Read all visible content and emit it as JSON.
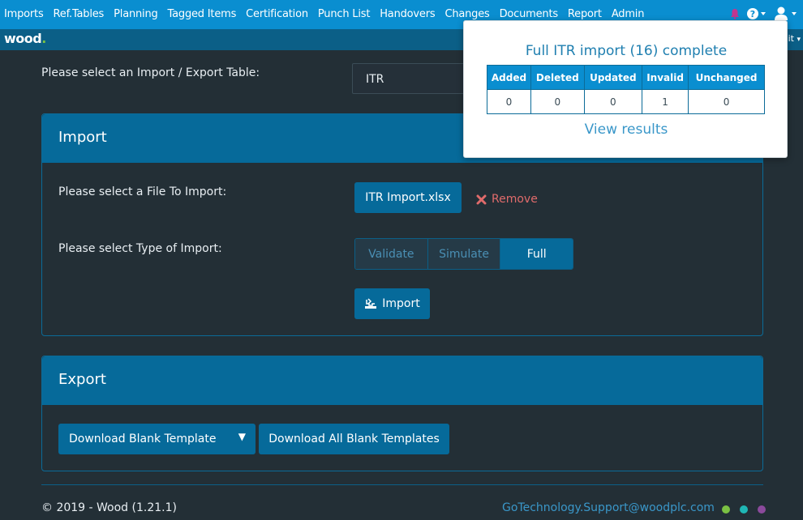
{
  "nav": {
    "items": [
      "Imports",
      "Ref.Tables",
      "Planning",
      "Tagged Items",
      "Certification",
      "Punch List",
      "Handovers",
      "Changes",
      "Documents",
      "Report",
      "Admin"
    ]
  },
  "icons": {
    "bell": "bell-icon",
    "help": "help-icon",
    "user": "user-icon"
  },
  "brand": {
    "logo_text": "wood",
    "logo_dot": ".",
    "subbar_right": "it"
  },
  "form": {
    "select_label": "Please select an Import / Export Table:",
    "select_value": "ITR"
  },
  "import": {
    "title": "Import",
    "file_label": "Please select a File To Import:",
    "file_button": "ITR Import.xlsx",
    "remove_label": "Remove",
    "type_label": "Please select Type of Import:",
    "types": [
      "Validate",
      "Simulate",
      "Full"
    ],
    "selected_type": "Full",
    "import_button": "Import"
  },
  "export": {
    "title": "Export",
    "download_blank": "Download Blank Template",
    "download_all": "Download All Blank Templates"
  },
  "footer": {
    "copyright": "© 2019 - Wood (1.21.1)",
    "support_email": "GoTechnology.Support@woodplc.com",
    "dot_colors": [
      "#7bc143",
      "#1fb7b5",
      "#8b4a9c"
    ]
  },
  "popup": {
    "title": "Full ITR import (16) complete",
    "columns": [
      "Added",
      "Deleted",
      "Updated",
      "Invalid",
      "Unchanged"
    ],
    "values": [
      "0",
      "0",
      "0",
      "1",
      "0"
    ],
    "link": "View results"
  },
  "colors": {
    "nav": "#0a8ed0",
    "panel_header": "#066a9a",
    "background": "#232f36",
    "remove": "#e06b6b"
  }
}
